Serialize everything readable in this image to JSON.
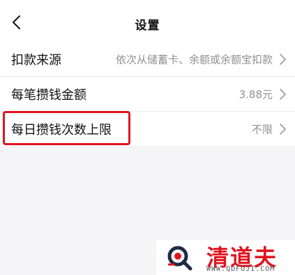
{
  "header": {
    "title": "设置"
  },
  "settings": {
    "items": [
      {
        "label": "扣款来源",
        "value": "依次从储蓄卡、余额或余额宝扣款"
      },
      {
        "label": "每笔攒钱金额",
        "value": "3.88元"
      },
      {
        "label": "每日攒钱次数上限",
        "value": "不限"
      }
    ]
  },
  "watermark": {
    "brand": "清道夫",
    "url": "WWW.QDFUJI.COM"
  },
  "colors": {
    "highlight": "#e0141e",
    "value_text": "#8f8f8f",
    "background": "#f5f5f7"
  },
  "icons": {
    "back": "chevron-left-icon",
    "row_arrow": "chevron-right-icon",
    "watermark_logo": "magnifier-q-logo"
  }
}
